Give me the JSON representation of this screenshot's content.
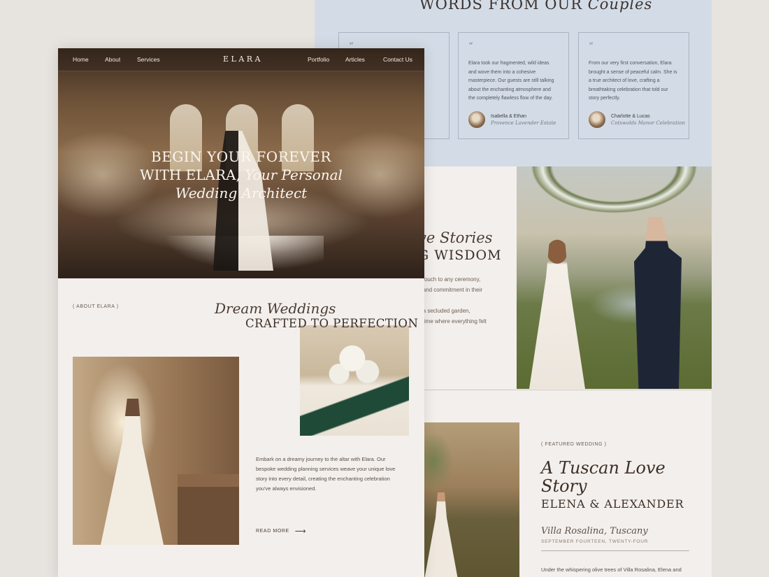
{
  "testimonials": {
    "title": "WORDS FROM OUR",
    "title_script": "Couples",
    "cards": [
      {
        "quote_mark": "“",
        "text": "",
        "name": "",
        "place": ""
      },
      {
        "quote_mark": "“",
        "text": "Elara took our fragmented, wild ideas and wove them into a cohesive masterpiece. Our guests are still talking about the enchanting atmosphere and the completely flawless flow of the day.",
        "name": "Isabella & Ethan",
        "place": "Provence Lavender Estate"
      },
      {
        "quote_mark": "“",
        "text": "From our very first conversation, Elara brought a sense of peaceful calm. She is a true architect of love, crafting a breathtaking celebration that told our story perfectly.",
        "name": "Charlotte & Lucas",
        "place": "Cotswolds Manor Celebration"
      }
    ]
  },
  "love_stories": {
    "script": "ve Stories",
    "heading": "G WISDOM",
    "lines": [
      "e touch to any ceremony,",
      "e and commitment in their",
      "",
      "n a secluded garden,",
      "n time where everything felt"
    ]
  },
  "featured": {
    "label": "( FEATURED WEDDING )",
    "script": "A Tuscan Love Story",
    "names": "ELENA & ALEXANDER",
    "place": "Villa Rosalina, Tuscany",
    "date": "SEPTEMBER FOURTEEN, TWENTY-FOUR",
    "body": "Under the whispering olive trees of Villa Rosalina, Elena and"
  },
  "nav": {
    "logo": "ELARA",
    "items": [
      "Home",
      "About",
      "Services",
      "Portfolio",
      "Articles",
      "Contact Us"
    ]
  },
  "hero": {
    "line1": "BEGIN YOUR FOREVER",
    "line2": "WITH ELARA,",
    "line2_script": "Your Personal",
    "line3": "Wedding Architect"
  },
  "about": {
    "label": "( ABOUT ELARA )",
    "script": "Dream Weddings",
    "heading": "CRAFTED TO PERFECTION",
    "body": "Embark on a dreamy journey to the altar with Elara. Our bespoke wedding planning services weave your unique love story into every detail, creating the enchanting celebration you've always envisioned.",
    "read_more": "READ MORE",
    "arrow": "⟶"
  }
}
